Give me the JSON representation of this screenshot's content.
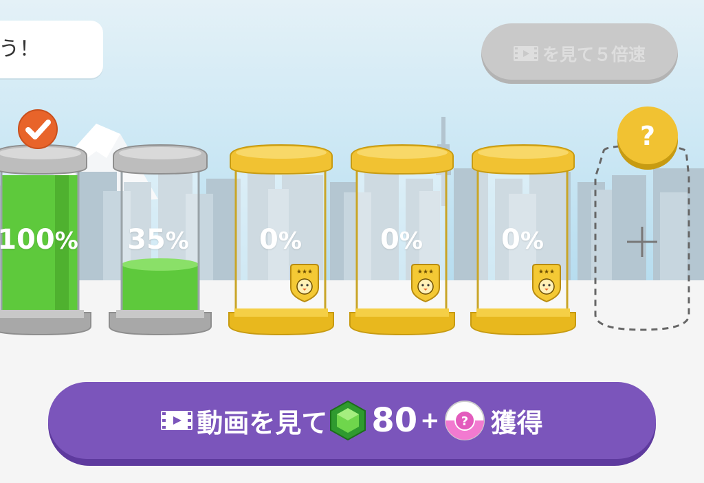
{
  "speech_bubble": {
    "text": "う！"
  },
  "speed_button": {
    "label": "を見て５倍速",
    "icon": "video-film-icon",
    "state": "disabled"
  },
  "jars": [
    {
      "percent": "100",
      "unit": "%",
      "fill": 1.0,
      "type": "silver",
      "completed": true
    },
    {
      "percent": "35",
      "unit": "%",
      "fill": 0.35,
      "type": "silver",
      "completed": false
    },
    {
      "percent": "0",
      "unit": "%",
      "fill": 0.0,
      "type": "gold",
      "badge": "penguin-three-star-badge"
    },
    {
      "percent": "0",
      "unit": "%",
      "fill": 0.0,
      "type": "gold",
      "badge": "penguin-three-star-badge"
    },
    {
      "percent": "0",
      "unit": "%",
      "fill": 0.0,
      "type": "gold",
      "badge": "penguin-three-star-badge"
    }
  ],
  "add_slot": {
    "coin_text": "?",
    "plus": "+"
  },
  "reward_button": {
    "prefix": "動画を見て",
    "gem_icon": "green-gem-icon",
    "amount": "80",
    "plus": "+",
    "capsule_icon": "mystery-capsule-icon",
    "capsule_text": "?",
    "suffix": "獲得"
  },
  "colors": {
    "fill_green": "#5ec93c",
    "silver": "#a9a9a9",
    "gold": "#f1c232",
    "reward_button": "#7b55bb",
    "check_orange": "#e8642a"
  }
}
